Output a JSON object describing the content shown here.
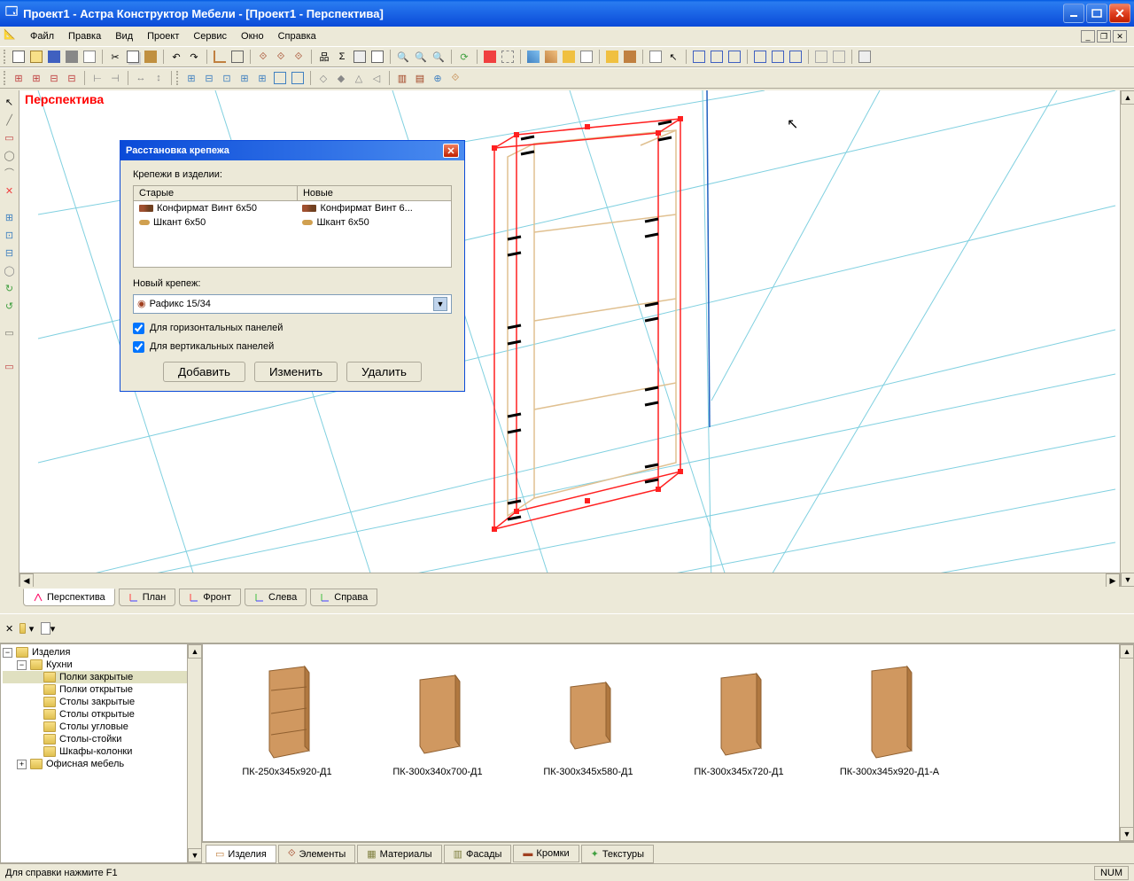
{
  "titlebar": "Проект1 - Астра Конструктор Мебели - [Проект1 - Перспектива]",
  "menu": {
    "file": "Файл",
    "edit": "Правка",
    "view": "Вид",
    "project": "Проект",
    "service": "Сервис",
    "window": "Окно",
    "help": "Справка"
  },
  "viewport": {
    "label": "Перспектива"
  },
  "view_tabs": [
    {
      "icon": "#ff0060",
      "label": "Перспектива"
    },
    {
      "icon": "#ff4040",
      "label": "План"
    },
    {
      "icon": "#ff4040",
      "label": "Фронт"
    },
    {
      "icon": "#40c040",
      "label": "Слева"
    },
    {
      "icon": "#40c040",
      "label": "Справа"
    }
  ],
  "tree": {
    "root": "Изделия",
    "kitchens": "Кухни",
    "items": [
      "Полки закрытые",
      "Полки открытые",
      "Столы закрытые",
      "Столы открытые",
      "Столы угловые",
      "Столы-стойки",
      "Шкафы-колонки"
    ],
    "office": "Офисная мебель"
  },
  "catalog": {
    "items": [
      "ПК-250х345х920-Д1",
      "ПК-300х340х700-Д1",
      "ПК-300х345х580-Д1",
      "ПК-300х345х720-Д1",
      "ПК-300х345х920-Д1-А"
    ],
    "tabs": [
      "Изделия",
      "Элементы",
      "Материалы",
      "Фасады",
      "Кромки",
      "Текстуры"
    ]
  },
  "statusbar": {
    "help": "Для справки нажмите F1",
    "num": "NUM"
  },
  "dialog": {
    "title": "Расстановка крепежа",
    "label_existing": "Крепежи в изделии:",
    "col_old": "Старые",
    "col_new": "Новые",
    "row1_old": "Конфирмат Винт 6х50",
    "row1_new": "Конфирмат Винт 6...",
    "row2_old": "Шкант 6х50",
    "row2_new": "Шкант 6х50",
    "label_new": "Новый крепеж:",
    "select_value": "Рафикс 15/34",
    "check_horiz": "Для горизонтальных панелей",
    "check_vert": "Для вертикальных панелей",
    "btn_add": "Добавить",
    "btn_edit": "Изменить",
    "btn_del": "Удалить"
  }
}
